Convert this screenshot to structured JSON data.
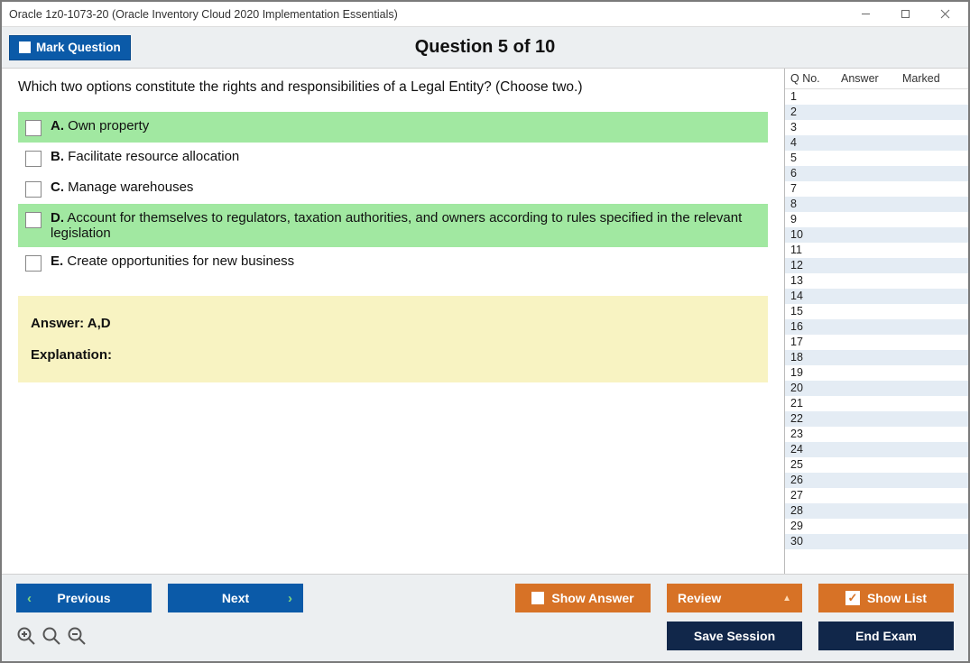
{
  "window": {
    "title": "Oracle 1z0-1073-20 (Oracle Inventory Cloud 2020 Implementation Essentials)"
  },
  "header": {
    "mark_label": "Mark Question",
    "question_title": "Question 5 of 10"
  },
  "question": {
    "text": "Which two options constitute the rights and responsibilities of a Legal Entity? (Choose two.)",
    "options": [
      {
        "letter": "A.",
        "text": "Own property",
        "correct": true
      },
      {
        "letter": "B.",
        "text": "Facilitate resource allocation",
        "correct": false
      },
      {
        "letter": "C.",
        "text": "Manage warehouses",
        "correct": false
      },
      {
        "letter": "D.",
        "text": "Account for themselves to regulators, taxation authorities, and owners according to rules specified in the relevant legislation",
        "correct": true
      },
      {
        "letter": "E.",
        "text": "Create opportunities for new business",
        "correct": false
      }
    ]
  },
  "answer": {
    "line": "Answer: A,D",
    "explanation_label": "Explanation:"
  },
  "list": {
    "headers": {
      "q": "Q No.",
      "a": "Answer",
      "m": "Marked"
    },
    "rows": [
      1,
      2,
      3,
      4,
      5,
      6,
      7,
      8,
      9,
      10,
      11,
      12,
      13,
      14,
      15,
      16,
      17,
      18,
      19,
      20,
      21,
      22,
      23,
      24,
      25,
      26,
      27,
      28,
      29,
      30
    ]
  },
  "footer": {
    "previous": "Previous",
    "next": "Next",
    "show_answer": "Show Answer",
    "review": "Review",
    "show_list": "Show List",
    "save_session": "Save Session",
    "end_exam": "End Exam"
  }
}
